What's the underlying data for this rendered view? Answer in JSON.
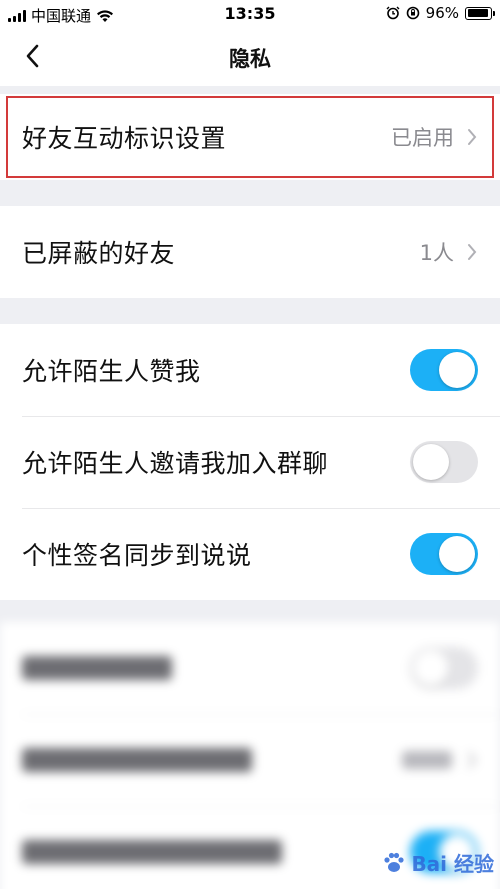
{
  "status_bar": {
    "carrier": "中国联通",
    "time": "13:35",
    "battery": "96%",
    "battery_level": 0.96,
    "icons": [
      "signal-icon",
      "wifi-icon",
      "alarm-icon",
      "orientation-lock-icon",
      "battery-icon"
    ]
  },
  "nav": {
    "title": "隐私",
    "back_icon": "chevron-left-icon"
  },
  "sections": {
    "friend_interaction": {
      "label": "好友互动标识设置",
      "value": "已启用"
    },
    "blocked_friends": {
      "label": "已屏蔽的好友",
      "value": "1人"
    },
    "toggles": [
      {
        "label": "允许陌生人赞我",
        "on": true
      },
      {
        "label": "允许陌生人邀请我加入群聊",
        "on": false
      },
      {
        "label": "个性签名同步到说说",
        "on": true
      }
    ]
  },
  "colors": {
    "toggle_on": "#1cb0f6",
    "toggle_off": "#e4e4e7",
    "highlight": "#d33a3a",
    "background": "#eeeff3"
  },
  "watermark": {
    "text": "Bai 经验",
    "icon": "baidu-paw-icon"
  }
}
